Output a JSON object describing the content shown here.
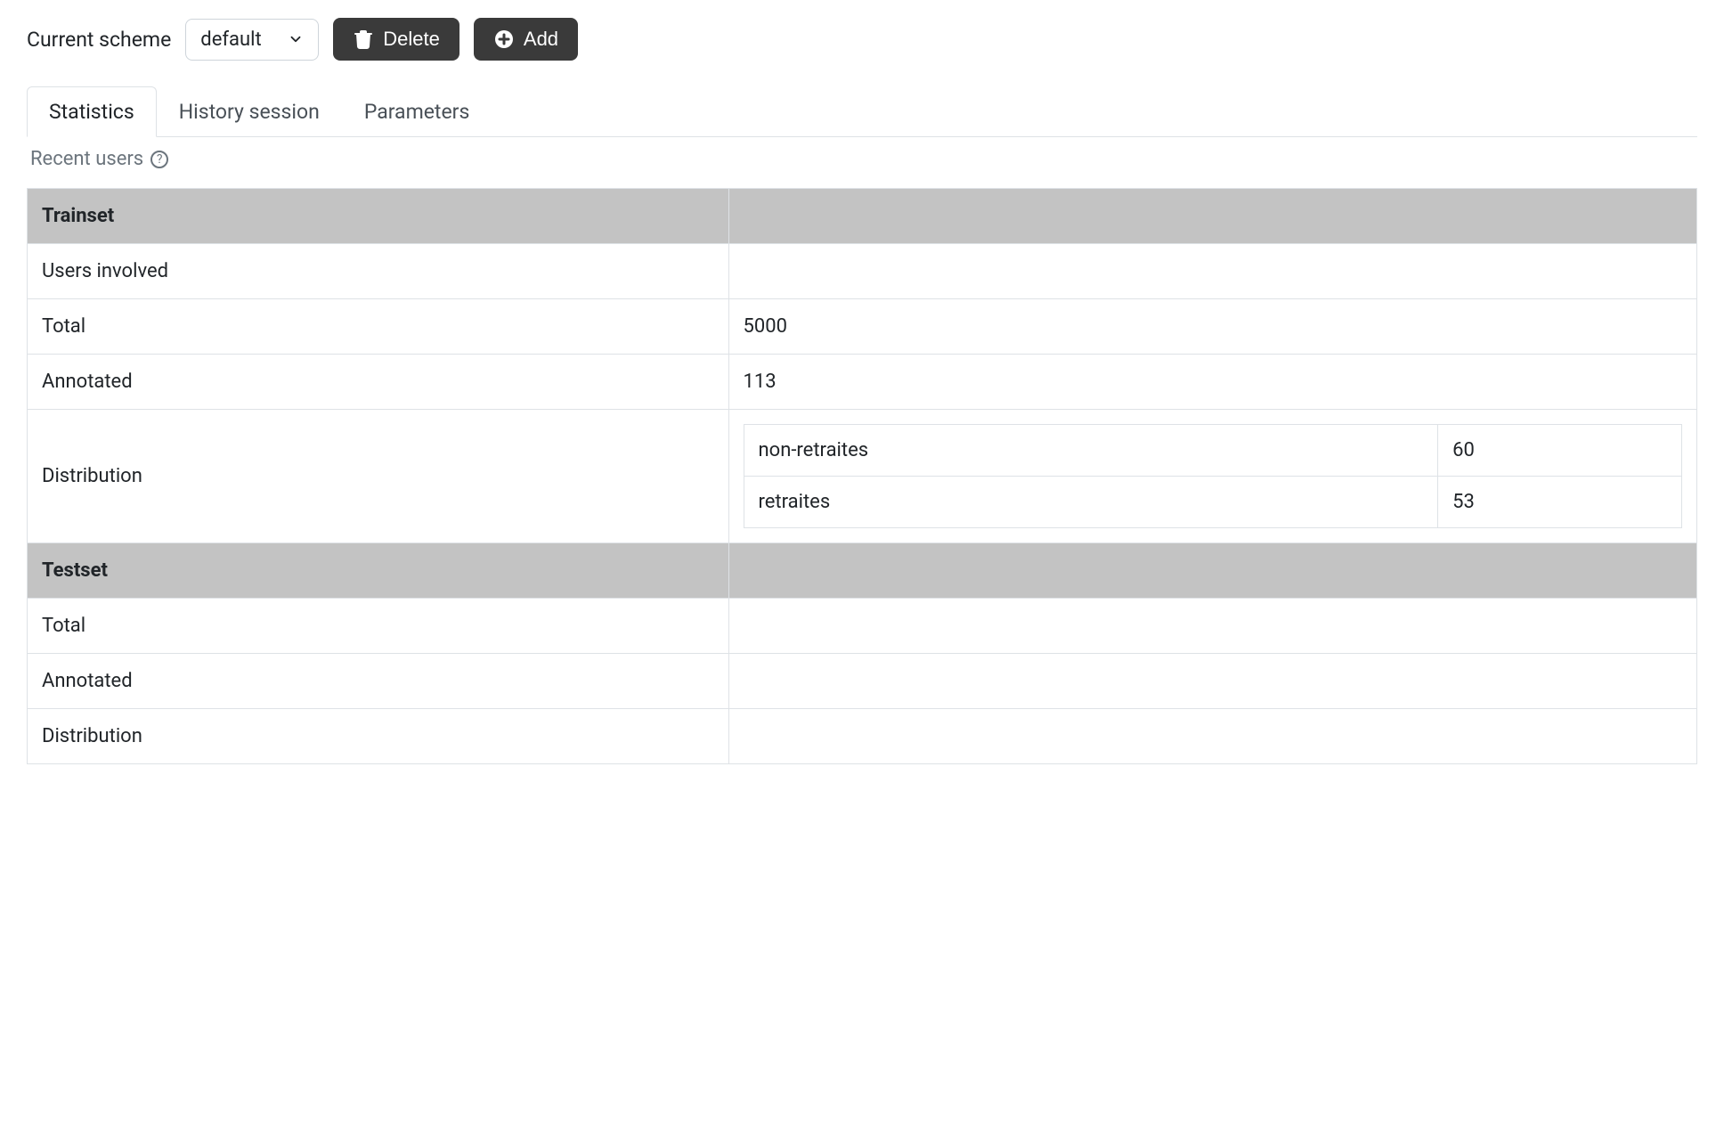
{
  "toolbar": {
    "label": "Current scheme",
    "scheme_selected": "default",
    "delete_label": "Delete",
    "add_label": "Add"
  },
  "tabs": {
    "statistics": "Statistics",
    "history": "History session",
    "parameters": "Parameters"
  },
  "subheader": {
    "recent_users": "Recent users"
  },
  "stats": {
    "trainset": {
      "header": "Trainset",
      "users_involved_label": "Users involved",
      "users_involved_value": "",
      "total_label": "Total",
      "total_value": "5000",
      "annotated_label": "Annotated",
      "annotated_value": "113",
      "distribution_label": "Distribution",
      "distribution": [
        {
          "label": "non-retraites",
          "count": "60"
        },
        {
          "label": "retraites",
          "count": "53"
        }
      ]
    },
    "testset": {
      "header": "Testset",
      "total_label": "Total",
      "total_value": "",
      "annotated_label": "Annotated",
      "annotated_value": "",
      "distribution_label": "Distribution",
      "distribution_value": ""
    }
  }
}
